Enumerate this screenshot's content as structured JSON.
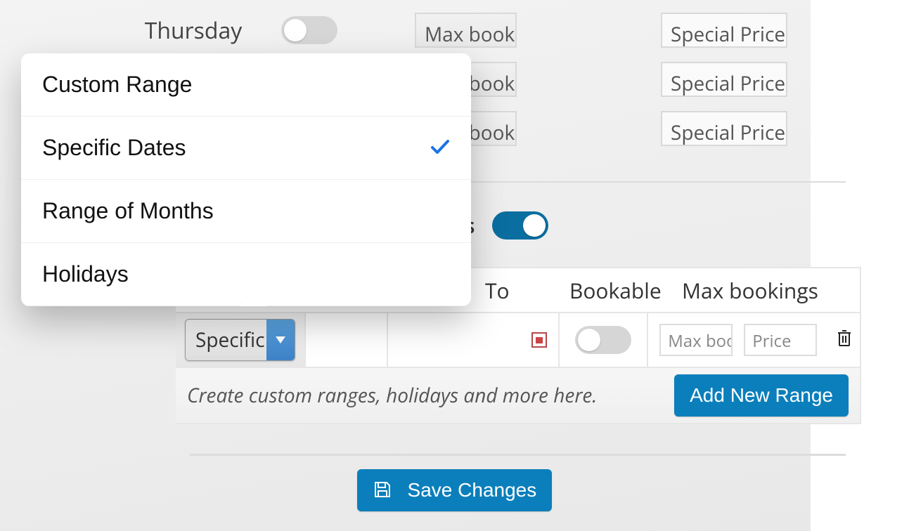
{
  "weekdays": {
    "thursday": {
      "label": "Thursday"
    }
  },
  "inputs": {
    "max_placeholder": "Max bookings",
    "price_placeholder": "Special Price"
  },
  "section": {
    "label_end": "ths"
  },
  "table": {
    "headers": {
      "to": "To",
      "bookable": "Bookable",
      "max": "Max bookings"
    },
    "row": {
      "type_selected": "Specific Dates",
      "max_placeholder": "Max bookings",
      "price_placeholder": "Price"
    },
    "footer_note": "Create custom ranges, holidays and more here.",
    "add_button": "Add New Range"
  },
  "save_button": "Save Changes",
  "popover": {
    "options": [
      "Custom Range",
      "Specific Dates",
      "Range of Months",
      "Holidays"
    ],
    "selected_index": 1
  }
}
